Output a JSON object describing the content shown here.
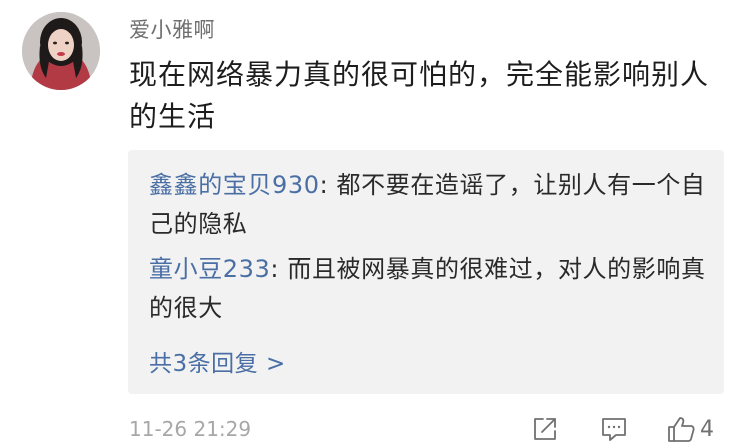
{
  "post": {
    "username": "爱小雅啊",
    "comment": "现在网络暴力真的很可怕的，完全能影响别人的生活",
    "timestamp": "11-26 21:29",
    "like_count": "4"
  },
  "replies": [
    {
      "user": "鑫鑫的宝贝930",
      "separator": ": ",
      "text": "都不要在造谣了，让别人有一个自己的隐私"
    },
    {
      "user": "童小豆233",
      "separator": ": ",
      "text": "而且被网暴真的很难过，对人的影响真的很大"
    }
  ],
  "view_all_label": "共3条回复 >",
  "colors": {
    "link": "#4a6fa5",
    "reply_background": "#f2f2f2",
    "meta_text": "#a7a7a7"
  },
  "icons": {
    "share": "share-icon",
    "comment": "comment-icon",
    "like": "like-icon"
  }
}
